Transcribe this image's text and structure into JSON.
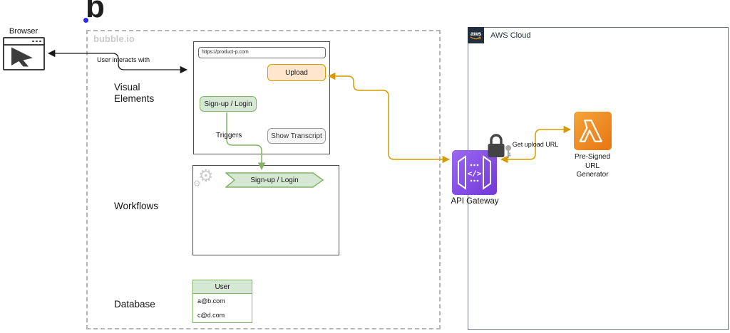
{
  "logo": {
    "letter": "b"
  },
  "browser_icon": {
    "label": "Browser"
  },
  "bubble_box": {
    "title": "bubble.io",
    "sections": [
      {
        "label": "Visual Elements"
      },
      {
        "label": "Workflows"
      },
      {
        "label": "Database"
      }
    ]
  },
  "mockup": {
    "url": "https://product-p.com",
    "upload_button": "Upload",
    "signup_button": "Sign-up / Login",
    "transcript_button": "Show Transcript",
    "triggers_label": "Triggers"
  },
  "workflow": {
    "step_label": "Sign-up / Login"
  },
  "database": {
    "table_header": "User",
    "rows": [
      "a@b.com",
      "c@d.com"
    ]
  },
  "aws": {
    "logo_text": "aws",
    "title": "AWS Cloud",
    "api_gateway_label": "API Gateway",
    "lambda_label": "Pre-Signed URL Generator",
    "get_upload_url_label": "Get upload URL"
  },
  "arrows": {
    "user_interacts_label": "User interacts with"
  },
  "colors": {
    "green_fill": "#d5e8d4",
    "green_stroke": "#82b366",
    "orange_fill": "#ffe6cc",
    "orange_stroke": "#d79b00",
    "purple_icon": "#8450e0",
    "lambda_icon": "#ed7100",
    "aws_navy": "#232F3E",
    "bubble_dot_blue": "#2b2bf0"
  }
}
